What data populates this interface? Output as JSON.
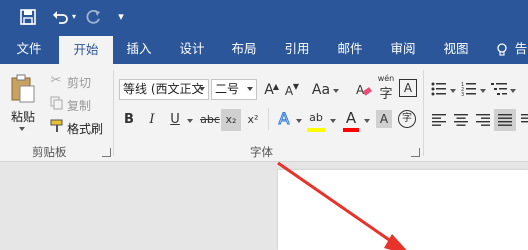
{
  "colors": {
    "brand": "#2b579a",
    "ribbon": "#f3f3f3",
    "arrow": "#e8332a",
    "underline_yellow": "#ffff00",
    "font_red": "#ff0000"
  },
  "tabs": [
    "文件",
    "开始",
    "插入",
    "设计",
    "布局",
    "引用",
    "邮件",
    "审阅",
    "视图",
    "告"
  ],
  "active_tab": "开始",
  "qat": {
    "save": "save-icon",
    "undo": "undo-icon",
    "redo": "redo-icon",
    "customize": "customize-icon"
  },
  "clipboard": {
    "paste": "粘贴",
    "cut": "剪切",
    "copy": "复制",
    "format_painter": "格式刷",
    "group": "剪贴板"
  },
  "font": {
    "name": "等线 (西文正文",
    "size": "二号",
    "grow": "A",
    "shrink": "A",
    "case": "Aa",
    "bold": "B",
    "italic": "I",
    "underline": "U",
    "strike": "abc",
    "subscript": "x₂",
    "superscript": "x²",
    "group": "字体",
    "phonetic": "wén",
    "char_border": "A",
    "effects": "A",
    "highlight": "ab",
    "font_color": "A",
    "shading": "A",
    "enclose": "字"
  }
}
